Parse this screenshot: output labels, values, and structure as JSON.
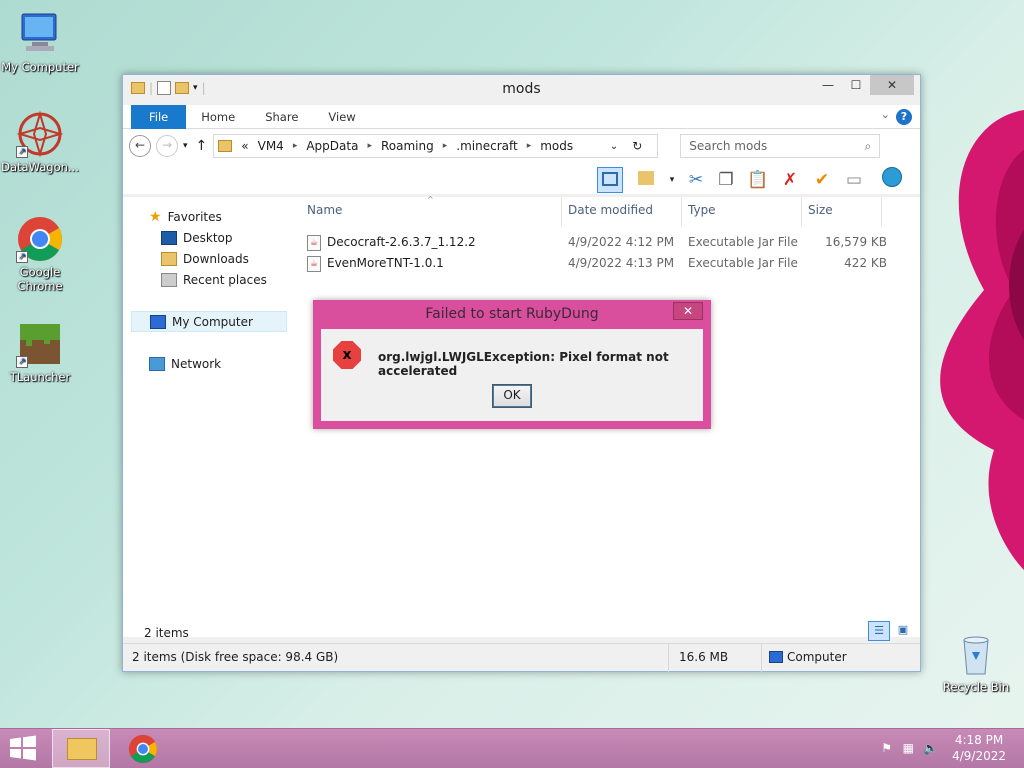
{
  "desktop": {
    "icons": [
      {
        "label": "My Computer"
      },
      {
        "label": "DataWagon..."
      },
      {
        "label": "Google Chrome"
      },
      {
        "label": "TLauncher"
      },
      {
        "label": "Recycle Bin"
      }
    ]
  },
  "explorer": {
    "title": "mods",
    "ribbon": {
      "tabs": [
        "File",
        "Home",
        "Share",
        "View"
      ]
    },
    "address": {
      "prefix": "«",
      "parts": [
        "VM4",
        "AppData",
        "Roaming",
        ".minecraft",
        "mods"
      ]
    },
    "search": {
      "placeholder": "Search mods"
    },
    "nav": {
      "favorites": "Favorites",
      "items": [
        "Desktop",
        "Downloads",
        "Recent places"
      ],
      "my_computer": "My Computer",
      "network": "Network"
    },
    "columns": [
      "Name",
      "Date modified",
      "Type",
      "Size"
    ],
    "files": [
      {
        "name": "Decocraft-2.6.3.7_1.12.2",
        "date": "4/9/2022 4:12 PM",
        "type": "Executable Jar File",
        "size": "16,579 KB"
      },
      {
        "name": "EvenMoreTNT-1.0.1",
        "date": "4/9/2022 4:13 PM",
        "type": "Executable Jar File",
        "size": "422 KB"
      }
    ],
    "item_count": "2 items",
    "status": {
      "left": "2 items (Disk free space: 98.4 GB)",
      "size": "16.6 MB",
      "location": "Computer"
    }
  },
  "dialog": {
    "title": "Failed to start RubyDung",
    "close": "✕",
    "message": "org.lwjgl.LWJGLException: Pixel format not accelerated",
    "ok": "OK"
  },
  "taskbar": {
    "time": "4:18 PM",
    "date": "4/9/2022"
  }
}
